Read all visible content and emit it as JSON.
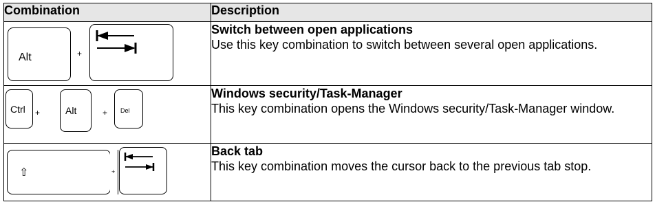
{
  "header": {
    "col1": "Combination",
    "col2": "Description"
  },
  "rows": [
    {
      "keys": [
        "Alt",
        "+",
        "tab"
      ],
      "title": "Switch between open applications",
      "text": "Use this key combination to switch between several open applications."
    },
    {
      "keys": [
        "Ctrl",
        "+",
        "Alt",
        "+",
        "Del"
      ],
      "title": "Windows security/Task-Manager",
      "text": "This key combination opens the Windows security/Task-Manager window."
    },
    {
      "keys": [
        "⇧",
        "+",
        "tab"
      ],
      "title": "Back tab",
      "text": "This key combination moves the cursor back to the previous tab stop."
    }
  ],
  "icons": {
    "tab": "tab-key-icon",
    "shift": "shift-arrow-icon"
  }
}
